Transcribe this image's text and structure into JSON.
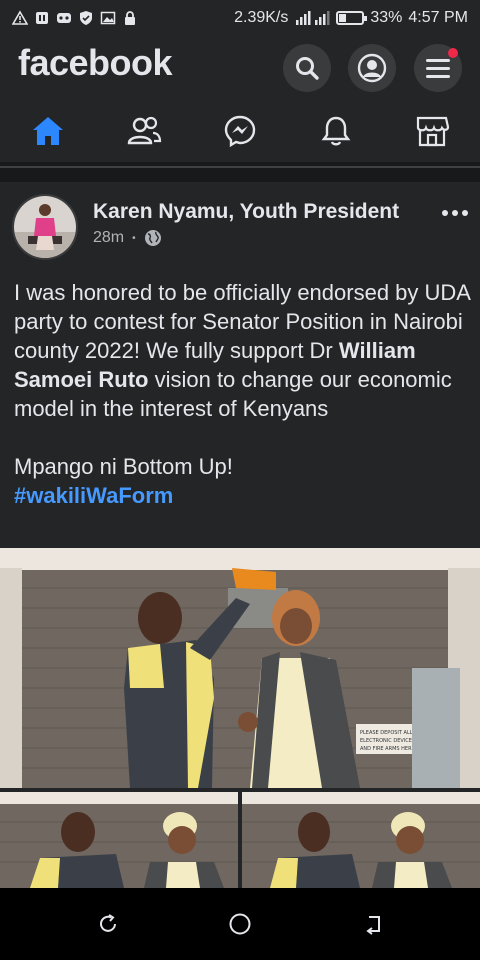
{
  "status_bar": {
    "speed": "2.39K/s",
    "battery_percent": "33%",
    "battery_level": 0.33,
    "time": "4:57 PM",
    "left_icons": [
      "warning-icon",
      "sim-icon",
      "game-icon",
      "shield-icon",
      "image-icon",
      "lock-icon"
    ]
  },
  "app_bar": {
    "logo": "facebook",
    "icons": [
      "search-icon",
      "profile-icon",
      "menu-icon"
    ],
    "notification_color": "#f02849"
  },
  "nav_tabs": [
    {
      "icon": "home-icon",
      "active": true
    },
    {
      "icon": "friends-icon",
      "active": false
    },
    {
      "icon": "messenger-icon",
      "active": false
    },
    {
      "icon": "bell-icon",
      "active": false
    },
    {
      "icon": "marketplace-icon",
      "active": false
    }
  ],
  "post": {
    "author": "Karen Nyamu, Youth President",
    "time": "28m",
    "privacy_icon": "globe-icon",
    "text_part1": "I was honored to be officially endorsed by UDA party to contest for Senator Position in Nairobi county 2022! We fully support Dr ",
    "text_bold": "William Samoei Ruto",
    "text_part2": " vision to change our economic model in the interest of Kenyans",
    "text_line2": "Mpango ni Bottom Up!",
    "hashtag": "#wakiliWaForm",
    "photo_sign": "PLEASE DEPOSIT ALL YOUR ELECTRONIC DEVICES AND FIRE ARMS HERE"
  },
  "colors": {
    "accent": "#2d88ff",
    "hashtag": "#4599ff",
    "background": "#18191a",
    "surface": "#242526"
  }
}
